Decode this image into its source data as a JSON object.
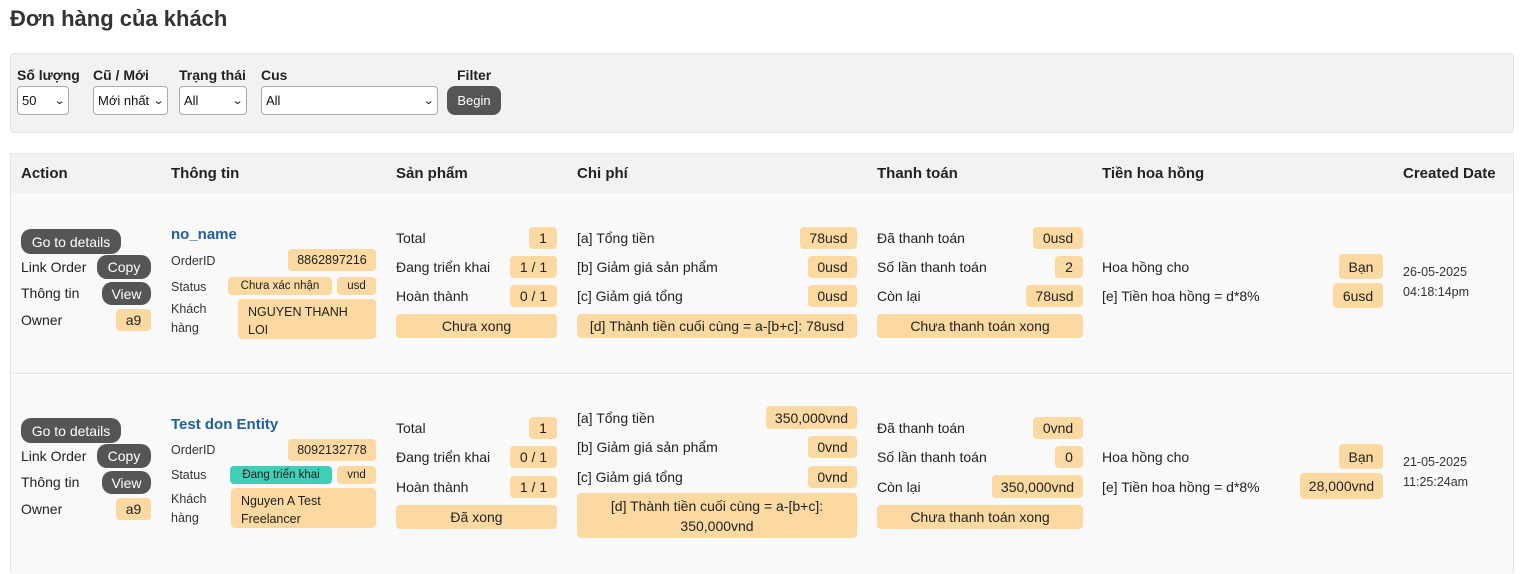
{
  "page": {
    "title": "Đơn hàng của khách"
  },
  "filters": {
    "quantity": {
      "label": "Số lượng",
      "value": "50"
    },
    "old_new": {
      "label": "Cũ / Mới",
      "value": "Mới nhất"
    },
    "status": {
      "label": "Trạng thái",
      "value": "All"
    },
    "cus": {
      "label": "Cus",
      "value": "All"
    },
    "filter": {
      "label": "Filter",
      "button": "Begin"
    }
  },
  "columns": [
    "Action",
    "Thông tin",
    "Sản phẩm",
    "Chi phí",
    "Thanh toán",
    "Tiền hoa hồng",
    "Created Date"
  ],
  "action_labels": {
    "go_details": "Go to details",
    "link_order": "Link Order",
    "copy": "Copy",
    "info": "Thông tin",
    "view": "View",
    "owner": "Owner"
  },
  "info_labels": {
    "order_id": "OrderID",
    "status": "Status",
    "customer_l1": "Khách",
    "customer_l2": "hàng"
  },
  "product_labels": {
    "total": "Total",
    "deploying": "Đang triển khai",
    "done": "Hoàn thành"
  },
  "cost_labels": {
    "a": "[a] Tổng tiền",
    "b": "[b] Giảm giá sản phẩm",
    "c": "[c] Giảm giá tổng"
  },
  "payment_labels": {
    "paid": "Đã thanh toán",
    "times": "Số lần thanh toán",
    "remaining": "Còn lại"
  },
  "commission_labels": {
    "for": "Hoa hồng cho",
    "e": "[e] Tiền hoa hồng = d*8%"
  },
  "orders": [
    {
      "owner": "a9",
      "name": "no_name",
      "order_id": "8862897216",
      "status": "Chưa xác nhận",
      "currency": "usd",
      "customer": "NGUYEN THANH LOI",
      "total": "1",
      "deploying": "1 / 1",
      "done": "0 / 1",
      "product_state": "Chưa xong",
      "a": "78usd",
      "b": "0usd",
      "c": "0usd",
      "d": "[d] Thành tiền cuối cùng = a-[b+c]: 78usd",
      "paid": "0usd",
      "times": "2",
      "remaining": "78usd",
      "payment_state": "Chưa thanh toán xong",
      "commission_for": "Bạn",
      "commission": "6usd",
      "created_date": "26-05-2025",
      "created_time": "04:18:14pm"
    },
    {
      "owner": "a9",
      "name": "Test don Entity",
      "order_id": "8092132778",
      "status": "Đang triển khai",
      "currency": "vnd",
      "customer": "Nguyen A Test Freelancer",
      "total": "1",
      "deploying": "0 / 1",
      "done": "1 / 1",
      "product_state": "Đã xong",
      "a": "350,000vnd",
      "b": "0vnd",
      "c": "0vnd",
      "d": "[d] Thành tiền cuối cùng = a-[b+c]: 350,000vnd",
      "paid": "0vnd",
      "times": "0",
      "remaining": "350,000vnd",
      "payment_state": "Chưa thanh toán xong",
      "commission_for": "Bạn",
      "commission": "28,000vnd",
      "created_date": "21-05-2025",
      "created_time": "11:25:24am"
    }
  ]
}
